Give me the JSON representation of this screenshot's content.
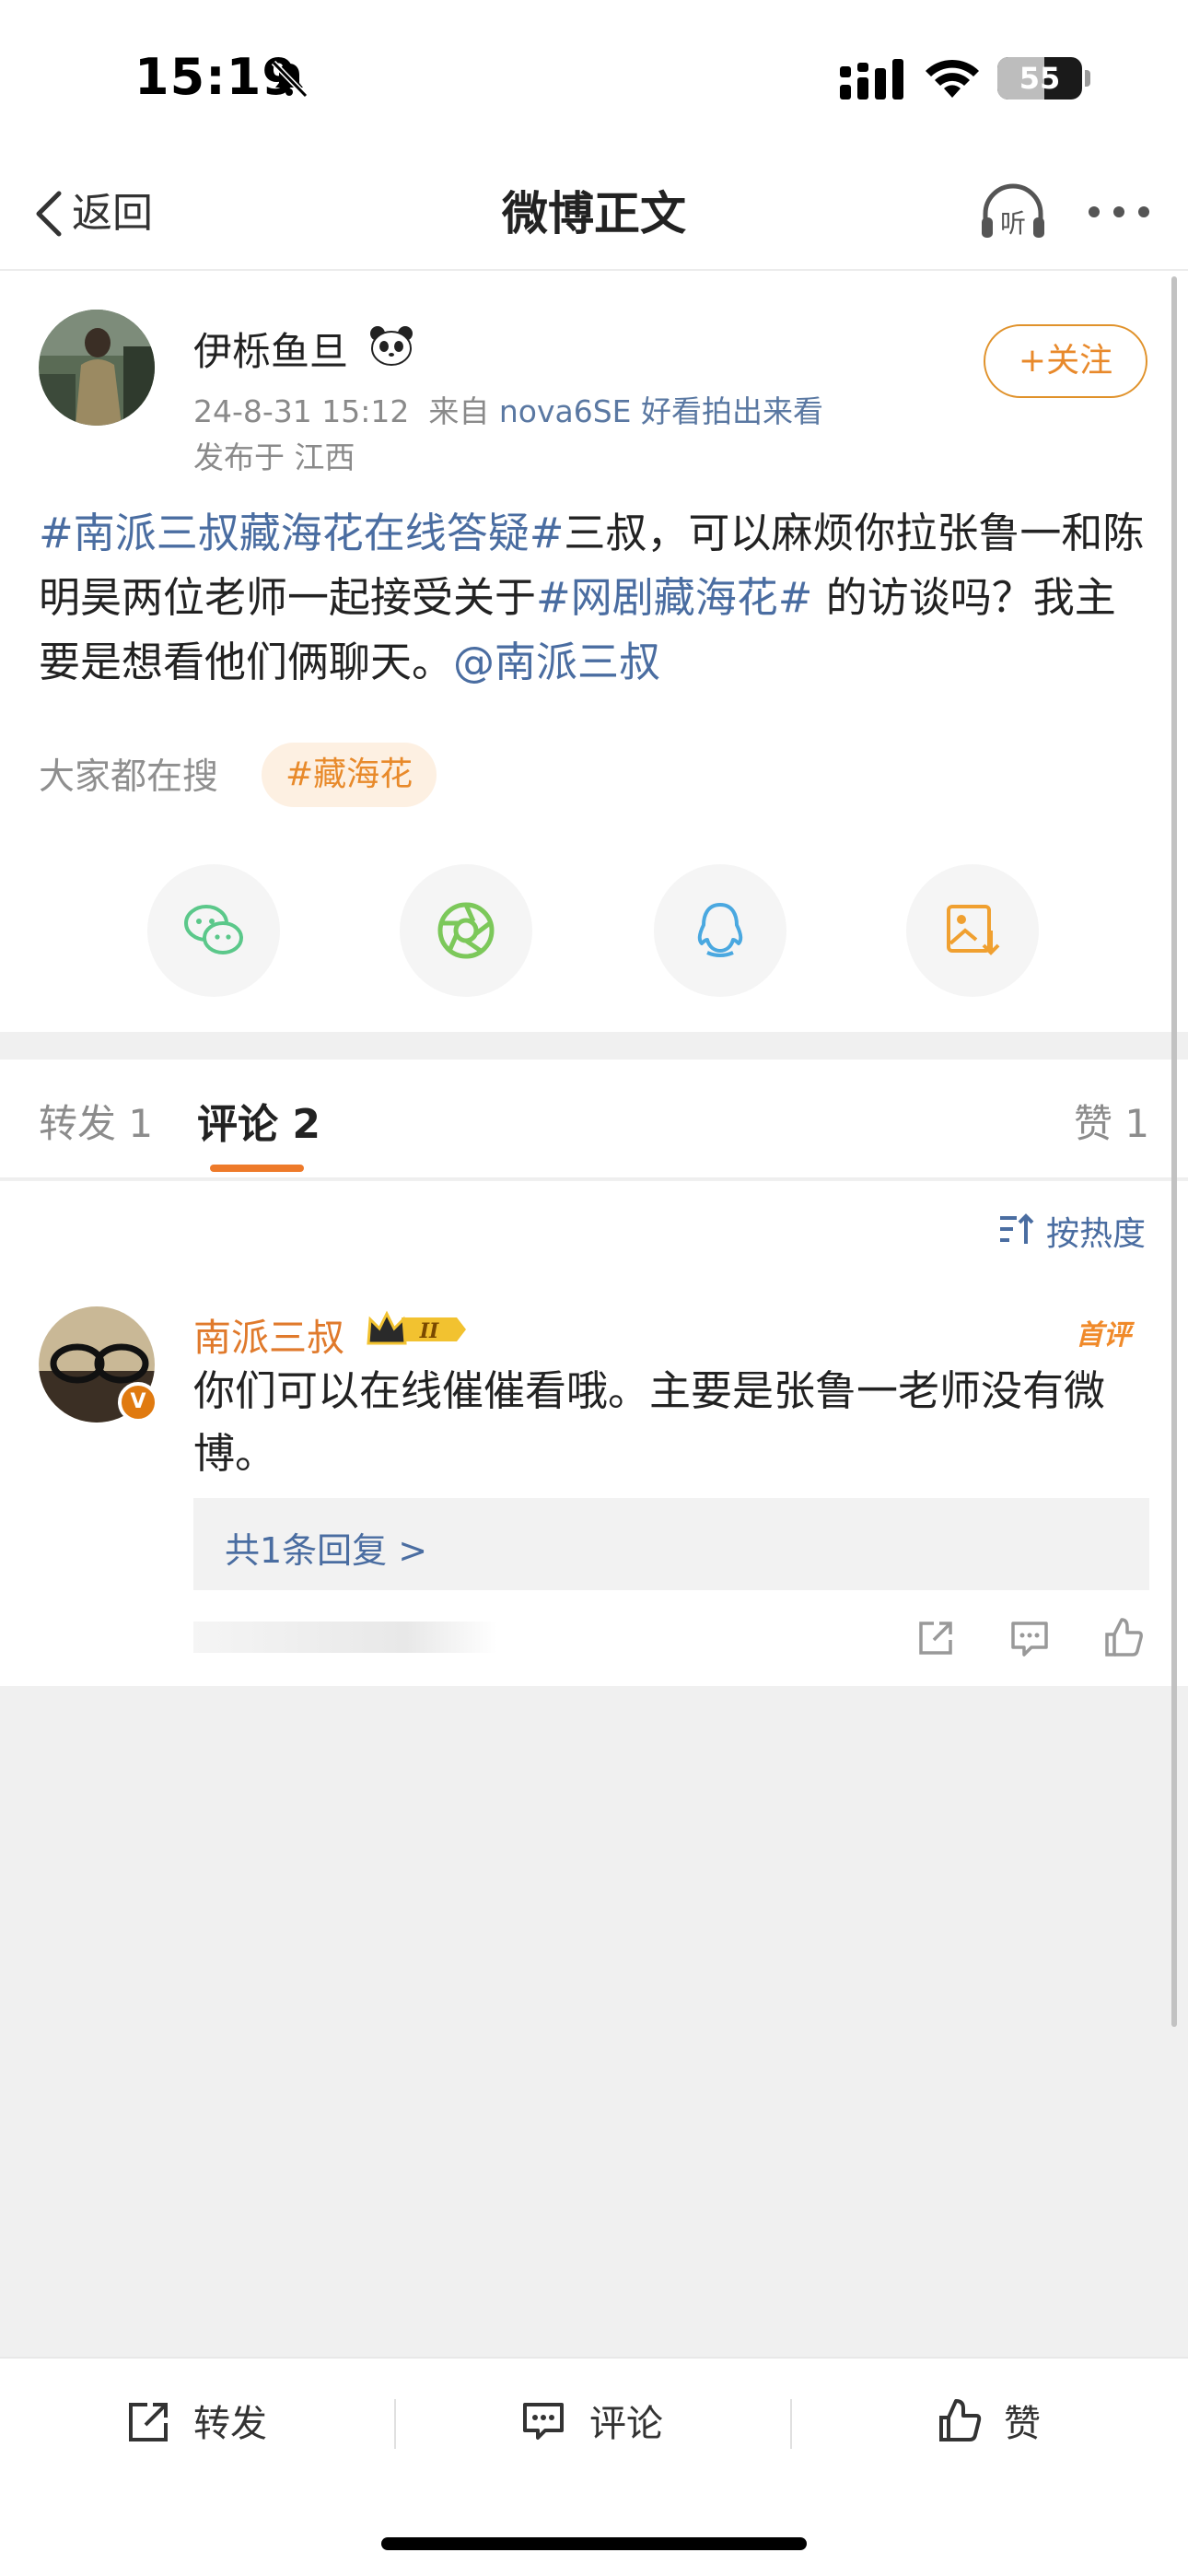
{
  "status_bar": {
    "time": "15:19",
    "battery": "55"
  },
  "nav": {
    "back_label": "返回",
    "title": "微博正文",
    "listen_label": "听"
  },
  "post": {
    "author": "伊栎鱼旦",
    "timestamp": "24-8-31 15:12",
    "source_prefix": "来自",
    "device": "nova6SE 好看拍出来看",
    "location": "发布于 江西",
    "follow_label": "+关注",
    "text_segments": [
      {
        "text": "#南派三叔藏海花在线答疑#",
        "link": true
      },
      {
        "text": "三叔，可以麻烦你拉张鲁一和陈明昊两位老师一起接受关于",
        "link": false
      },
      {
        "text": "#网剧藏海花#",
        "link": true
      },
      {
        "text": " 的访谈吗？我主要是想看他们俩聊天。",
        "link": false
      },
      {
        "text": "@南派三叔",
        "link": true
      }
    ],
    "search_label": "大家都在搜",
    "search_tag": "#藏海花"
  },
  "share_targets": [
    "wechat-icon",
    "moments-icon",
    "qq-icon",
    "save-image-icon"
  ],
  "tabs": {
    "repost": "转发 1",
    "comment": "评论 2",
    "like": "赞 1"
  },
  "sort": {
    "label": "按热度"
  },
  "comment": {
    "name": "南派三叔",
    "level": "II",
    "badge": "首评",
    "verified": "V",
    "text": "你们可以在线催催看哦。主要是张鲁一老师没有微博。",
    "reply_summary": "共1条回复 >"
  },
  "bottom_bar": {
    "repost": "转发",
    "comment": "评论",
    "like": "赞"
  },
  "colors": {
    "accent": "#e8892b",
    "link": "#4a6da1"
  }
}
